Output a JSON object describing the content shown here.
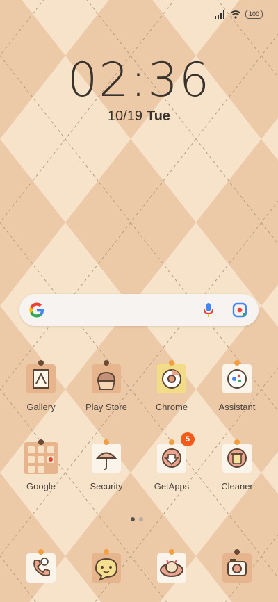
{
  "status": {
    "battery": "100"
  },
  "clock": {
    "time": "02:36",
    "date": "10/19",
    "weekday": "Tue"
  },
  "apps": [
    {
      "label": "Gallery",
      "icon": "gallery-icon"
    },
    {
      "label": "Play Store",
      "icon": "play-store-icon"
    },
    {
      "label": "Chrome",
      "icon": "chrome-icon"
    },
    {
      "label": "Assistant",
      "icon": "assistant-icon"
    },
    {
      "label": "Google",
      "icon": "google-folder-icon"
    },
    {
      "label": "Security",
      "icon": "security-icon"
    },
    {
      "label": "GetApps",
      "icon": "getapps-icon",
      "badge": "5"
    },
    {
      "label": "Cleaner",
      "icon": "cleaner-icon"
    }
  ],
  "dock": [
    {
      "icon": "phone-icon"
    },
    {
      "icon": "messages-icon"
    },
    {
      "icon": "browser-icon"
    },
    {
      "icon": "camera-icon"
    }
  ],
  "colors": {
    "bg_light": "#f6e3c9",
    "bg_dark": "#ebc7a5",
    "badge": "#f05a1a"
  }
}
